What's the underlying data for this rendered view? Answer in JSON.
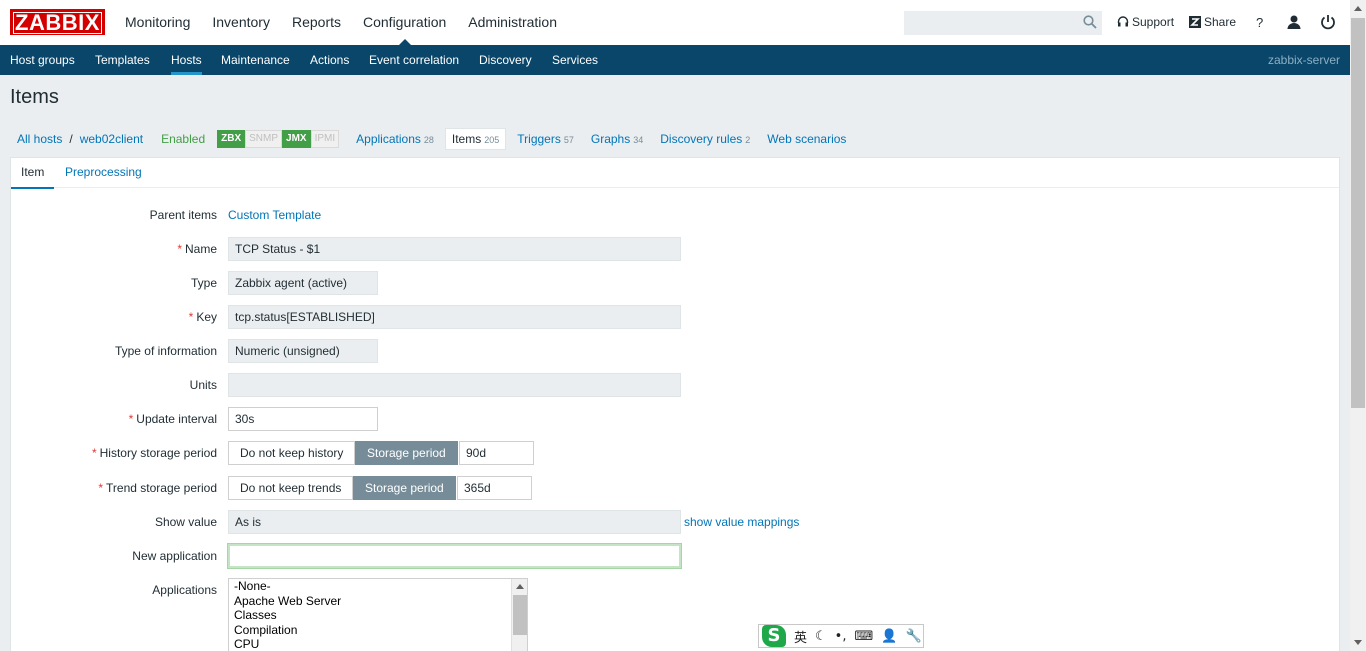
{
  "logo": "ZABBIX",
  "main_menu": [
    "Monitoring",
    "Inventory",
    "Reports",
    "Configuration",
    "Administration"
  ],
  "search": {
    "placeholder": "",
    "value": ""
  },
  "top_links": {
    "support": "Support",
    "share": "Share",
    "help": "?"
  },
  "sub_menu": [
    "Host groups",
    "Templates",
    "Hosts",
    "Maintenance",
    "Actions",
    "Event correlation",
    "Discovery",
    "Services"
  ],
  "server_name": "zabbix-server",
  "page_title": "Items",
  "breadcrumb": {
    "all_hosts": "All hosts",
    "sep": "/",
    "host": "web02client",
    "status": "Enabled"
  },
  "badges": [
    {
      "label": "ZBX",
      "on": true
    },
    {
      "label": "SNMP",
      "on": false
    },
    {
      "label": "JMX",
      "on": true
    },
    {
      "label": "IPMI",
      "on": false
    }
  ],
  "host_nav": [
    {
      "label": "Applications",
      "count": "28"
    },
    {
      "label": "Items",
      "count": "205"
    },
    {
      "label": "Triggers",
      "count": "57"
    },
    {
      "label": "Graphs",
      "count": "34"
    },
    {
      "label": "Discovery rules",
      "count": "2"
    },
    {
      "label": "Web scenarios",
      "count": ""
    }
  ],
  "tabs": [
    "Item",
    "Preprocessing"
  ],
  "form": {
    "parent_items": {
      "label": "Parent items",
      "value": "Custom Template"
    },
    "name": {
      "label": "Name",
      "value": "TCP Status - $1"
    },
    "type": {
      "label": "Type",
      "value": "Zabbix agent (active)"
    },
    "key": {
      "label": "Key",
      "value": "tcp.status[ESTABLISHED]"
    },
    "type_of_information": {
      "label": "Type of information",
      "value": "Numeric (unsigned)"
    },
    "units": {
      "label": "Units",
      "value": ""
    },
    "update_interval": {
      "label": "Update interval",
      "value": "30s"
    },
    "history": {
      "label": "History storage period",
      "opt1": "Do not keep history",
      "opt2": "Storage period",
      "value": "90d"
    },
    "trend": {
      "label": "Trend storage period",
      "opt1": "Do not keep trends",
      "opt2": "Storage period",
      "value": "365d"
    },
    "show_value": {
      "label": "Show value",
      "value": "As is",
      "link": "show value mappings"
    },
    "new_application": {
      "label": "New application",
      "value": ""
    },
    "applications": {
      "label": "Applications",
      "options": [
        "-None-",
        "Apache Web Server",
        "Classes",
        "Compilation",
        "CPU"
      ]
    }
  },
  "ime": {
    "lang": "英",
    "moon": "☾",
    "comma": "•,",
    "keyboard": "⌨",
    "user": "👤",
    "tool": "🔧"
  }
}
